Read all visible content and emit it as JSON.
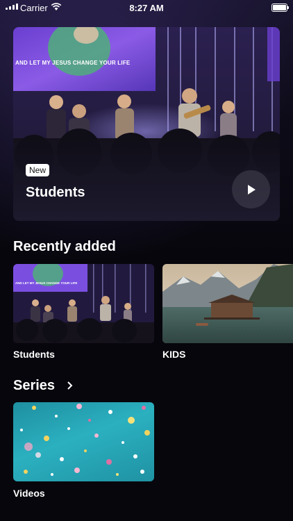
{
  "status_bar": {
    "carrier": "Carrier",
    "time": "8:27 AM"
  },
  "hero": {
    "screen_caption": "AND LET MY JESUS CHANGE YOUR LIFE",
    "badge": "New",
    "title": "Students",
    "play_icon": "play-icon"
  },
  "recently_added": {
    "title": "Recently added",
    "items": [
      {
        "label": "Students",
        "screen_caption": "AND LET MY JESUS CHANGE YOUR LIFE"
      },
      {
        "label": "KIDS"
      }
    ]
  },
  "series": {
    "title": "Series",
    "chevron_icon": "chevron-right-icon",
    "items": [
      {
        "label": "Videos"
      }
    ]
  },
  "colors": {
    "background": "#07060c",
    "card_surface": "#1d1a2d",
    "stage_purple": "#3b2a7a",
    "confetti_teal": "#2bb0c0"
  }
}
